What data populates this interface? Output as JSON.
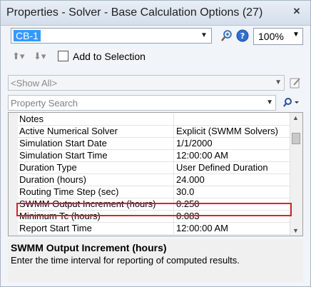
{
  "window": {
    "title": "Properties - Solver - Base Calculation Options (27)",
    "close_glyph": "✕"
  },
  "toolbar": {
    "element_value": "CB-1",
    "zoom_value": "100%",
    "add_to_selection_label": "Add to Selection"
  },
  "filter": {
    "value": "<Show All>"
  },
  "search": {
    "placeholder": "Property Search"
  },
  "grid": {
    "rows": [
      {
        "key": "Notes",
        "value": ""
      },
      {
        "key": "Active Numerical Solver",
        "value": "Explicit (SWMM Solvers)"
      },
      {
        "key": "Simulation Start Date",
        "value": "1/1/2000"
      },
      {
        "key": "Simulation Start Time",
        "value": "12:00:00 AM"
      },
      {
        "key": "Duration Type",
        "value": "User Defined Duration"
      },
      {
        "key": "Duration (hours)",
        "value": "24.000"
      },
      {
        "key": "Routing Time Step (sec)",
        "value": "30.0"
      },
      {
        "key": "SWMM Output Increment (hours)",
        "value": "0.250"
      },
      {
        "key": "Minimum Tc (hours)",
        "value": "0.083"
      },
      {
        "key": "Report Start Time",
        "value": "12:00:00 AM"
      }
    ]
  },
  "description": {
    "title": "SWMM Output Increment (hours)",
    "text": "Enter the time interval for reporting of computed results."
  },
  "colors": {
    "selection": "#3399ff",
    "highlight": "#d9222e"
  }
}
